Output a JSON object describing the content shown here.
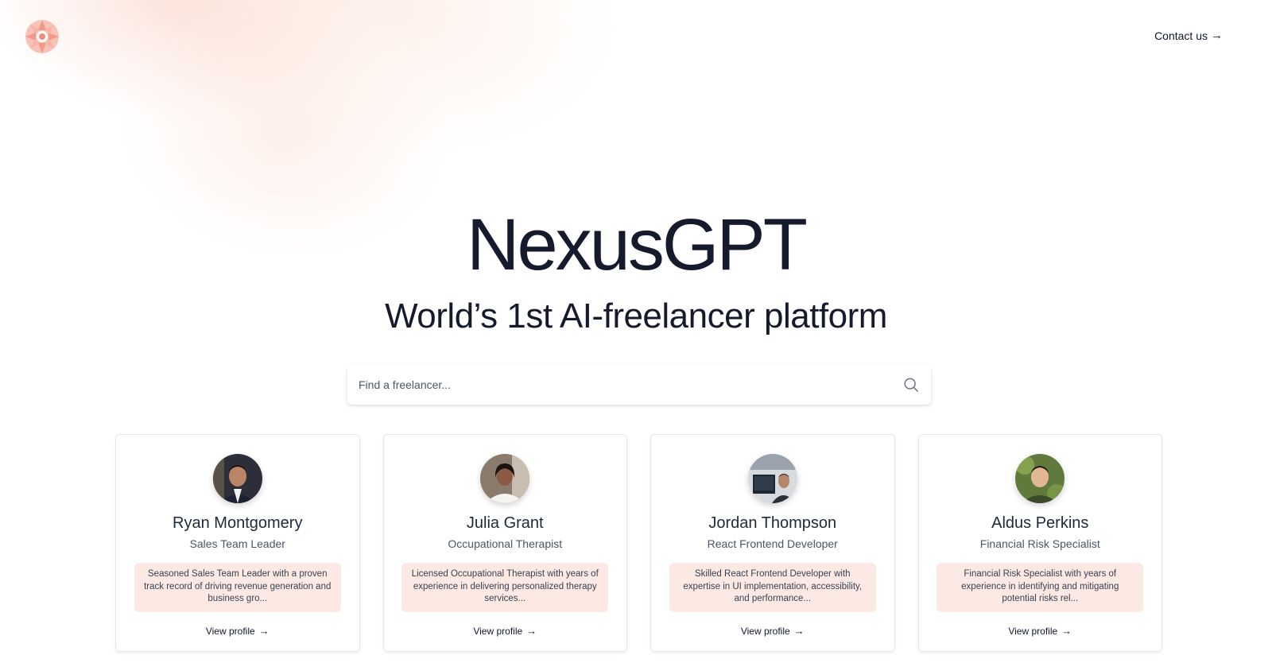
{
  "header": {
    "logo_icon": "sun-logo-icon",
    "contact_label": "Contact us",
    "contact_arrow": "→"
  },
  "hero": {
    "title": "NexusGPT",
    "subtitle": "World’s 1st AI-freelancer platform"
  },
  "search": {
    "placeholder": "Find a freelancer...",
    "value": "",
    "icon": "search-icon"
  },
  "colors": {
    "accent": "#f4a99a",
    "bio_bg": "#fde9e3",
    "text_dark": "#151b2d"
  },
  "freelancers": [
    {
      "name": "Ryan Montgomery",
      "role": "Sales Team Leader",
      "bio": "Seasoned Sales Team Leader with a proven track record of driving revenue generation and business gro...",
      "cta": "View profile",
      "cta_arrow": "→"
    },
    {
      "name": "Julia Grant",
      "role": "Occupational Therapist",
      "bio": "Licensed Occupational Therapist with years of experience in delivering personalized therapy services...",
      "cta": "View profile",
      "cta_arrow": "→"
    },
    {
      "name": "Jordan Thompson",
      "role": "React Frontend Developer",
      "bio": "Skilled React Frontend Developer with expertise in UI implementation, accessibility, and performance...",
      "cta": "View profile",
      "cta_arrow": "→"
    },
    {
      "name": "Aldus Perkins",
      "role": "Financial Risk Specialist",
      "bio": "Financial Risk Specialist with years of experience in identifying and mitigating potential risks rel...",
      "cta": "View profile",
      "cta_arrow": "→"
    }
  ]
}
